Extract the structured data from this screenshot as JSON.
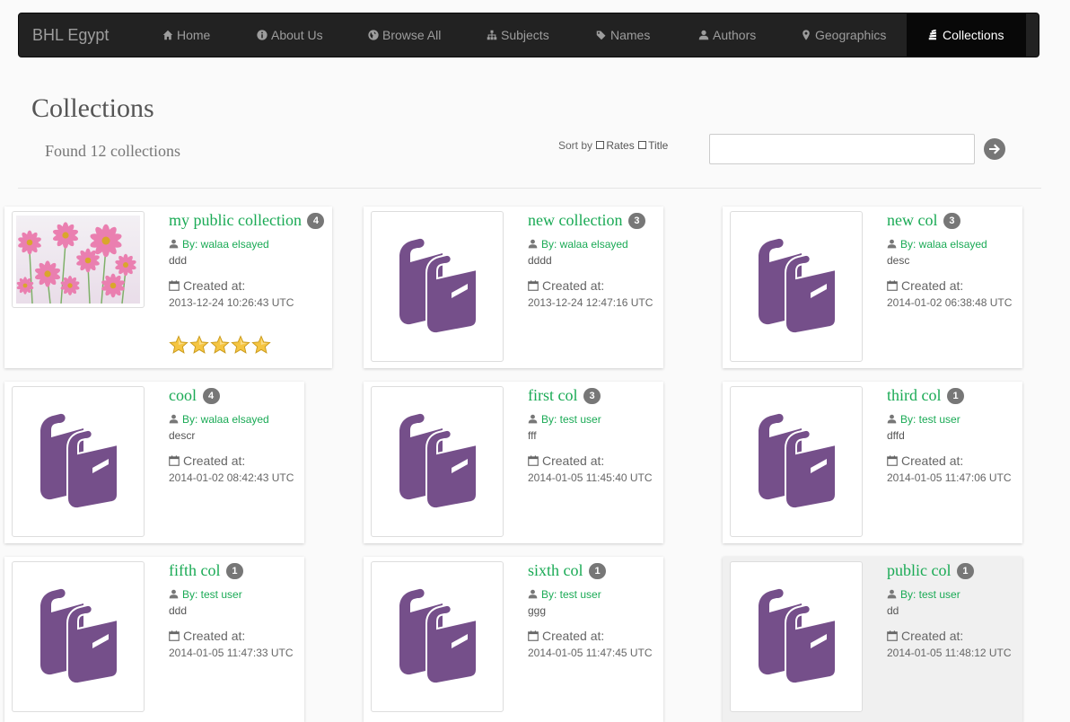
{
  "navbar": {
    "brand": "BHL Egypt",
    "items": [
      {
        "label": "Home",
        "icon": "home-icon"
      },
      {
        "label": "About Us",
        "icon": "info-icon"
      },
      {
        "label": "Browse All",
        "icon": "globe-icon"
      },
      {
        "label": "Subjects",
        "icon": "sitemap-icon"
      },
      {
        "label": "Names",
        "icon": "tags-icon"
      },
      {
        "label": "Authors",
        "icon": "user-icon"
      },
      {
        "label": "Geographics",
        "icon": "map-marker-icon"
      },
      {
        "label": "Collections",
        "icon": "stack-icon",
        "active": true
      }
    ]
  },
  "page": {
    "title": "Collections",
    "found": "Found 12 collections",
    "sort_label": "Sort by",
    "sort_rates": "Rates",
    "sort_title": "Title",
    "search_value": ""
  },
  "colors": {
    "accent_green": "#1aaa55",
    "book_purple": "#754f8a",
    "badge_gray": "#777777",
    "star_gold": "#f5c542"
  },
  "labels": {
    "by_prefix": "By: ",
    "created_at": "Created at:"
  },
  "collections": [
    {
      "title": "my public collection",
      "count": "4",
      "author": "By: walaa elsayed",
      "desc": "ddd",
      "created": "2013-12-24 10:26:43 UTC",
      "thumbnail": "flower-photo",
      "rating": 5
    },
    {
      "title": "new collection",
      "count": "3",
      "author": "By: walaa elsayed",
      "desc": "dddd",
      "created": "2013-12-24 12:47:16 UTC",
      "thumbnail": "books-icon"
    },
    {
      "title": "new col",
      "count": "3",
      "author": "By: walaa elsayed",
      "desc": "desc",
      "created": "2014-01-02 06:38:48 UTC",
      "thumbnail": "books-icon"
    },
    {
      "title": "cool",
      "count": "4",
      "author": "By: walaa elsayed",
      "desc": "descr",
      "created": "2014-01-02 08:42:43 UTC",
      "thumbnail": "books-icon"
    },
    {
      "title": "first col",
      "count": "3",
      "author": "By: test user",
      "desc": "fff",
      "created": "2014-01-05 11:45:40 UTC",
      "thumbnail": "books-icon"
    },
    {
      "title": "third col",
      "count": "1",
      "author": "By: test user",
      "desc": "dffd",
      "created": "2014-01-05 11:47:06 UTC",
      "thumbnail": "books-icon"
    },
    {
      "title": "fifth col",
      "count": "1",
      "author": "By: test user",
      "desc": "ddd",
      "created": "2014-01-05 11:47:33 UTC",
      "thumbnail": "books-icon"
    },
    {
      "title": "sixth col",
      "count": "1",
      "author": "By: test user",
      "desc": "ggg",
      "created": "2014-01-05 11:47:45 UTC",
      "thumbnail": "books-icon"
    },
    {
      "title": "public col",
      "count": "1",
      "author": "By: test user",
      "desc": "dd",
      "created": "2014-01-05 11:48:12 UTC",
      "thumbnail": "books-icon",
      "hovered": true
    }
  ]
}
